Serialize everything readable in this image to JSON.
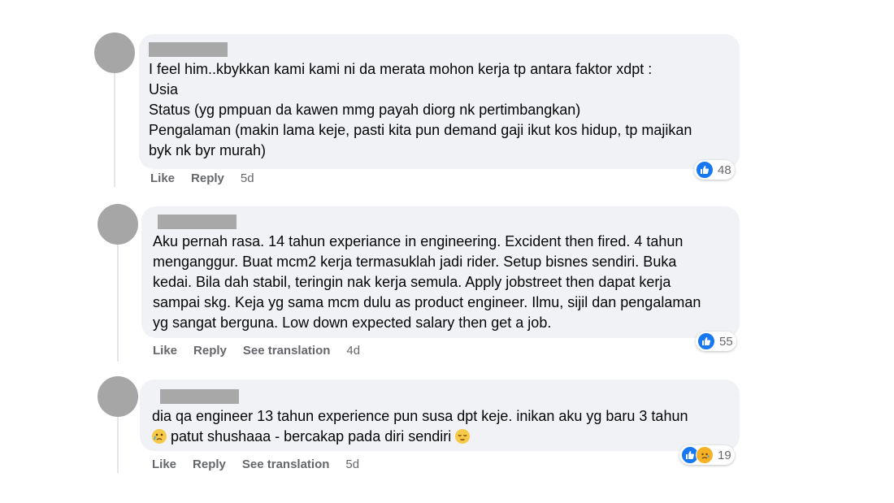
{
  "comments": [
    {
      "lines": [
        "I feel him..kbykkan kami kami ni da merata mohon kerja tp antara faktor xdpt :",
        "Usia",
        "Status (yg pmpuan da kawen mmg payah diorg nk pertimbangkan)",
        "Pengalaman (makin lama keje, pasti kita pun demand gaji ikut kos hidup, tp majikan",
        "byk nk byr murah)"
      ],
      "like": "Like",
      "reply": "Reply",
      "time": "5d",
      "reaction_count": "48"
    },
    {
      "lines": [
        "Aku pernah rasa. 14 tahun experiance in engineering. Excident then fired. 4 tahun",
        "menganggur. Buat mcm2 kerja termasuklah jadi rider. Setup bisnes sendiri. Buka",
        "kedai. Bila dah stabil, teringin nak kerja semula. Apply jobstreet then dapat kerja",
        "sampai skg. Keja yg sama mcm dulu as product engineer. Ilmu, sijil dan pengalaman",
        "yg sangat berguna. Low down expected salary then get a job."
      ],
      "like": "Like",
      "reply": "Reply",
      "translate": "See translation",
      "time": "4d",
      "reaction_count": "55"
    },
    {
      "line1": "dia qa engineer 13 tahun experience pun susa dpt keje. inikan aku yg baru 3 tahun",
      "line2": "patut shushaaa - bercakap pada diri sendiri",
      "like": "Like",
      "reply": "Reply",
      "translate": "See translation",
      "time": "5d",
      "reaction_count": "19"
    }
  ],
  "colors": {
    "bubble": "#f0f2f5",
    "like_blue": "#1877f2",
    "meta_gray": "#65676b",
    "avatar_gray": "#a6a6a6"
  },
  "icons": [
    "like-icon",
    "sad-icon",
    "crying-emoji",
    "relieved-emoji"
  ]
}
